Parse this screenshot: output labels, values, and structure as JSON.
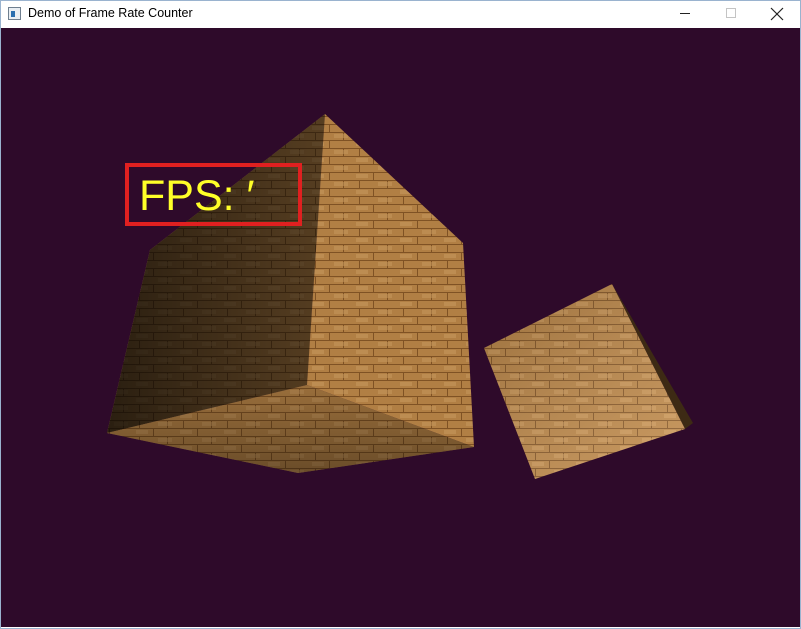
{
  "window": {
    "title": "Demo of Frame Rate Counter",
    "icon": "app-window-icon",
    "controls": [
      "minimize-icon",
      "maximize-icon",
      "close-icon"
    ]
  },
  "viewport": {
    "background_color": "#2e0a2a",
    "fps_label": "FPS: ′",
    "fps_text_color": "#ffff28",
    "highlight_color": "#e02020",
    "objects": [
      "wooden-cube-large",
      "wooden-cube-small"
    ]
  }
}
